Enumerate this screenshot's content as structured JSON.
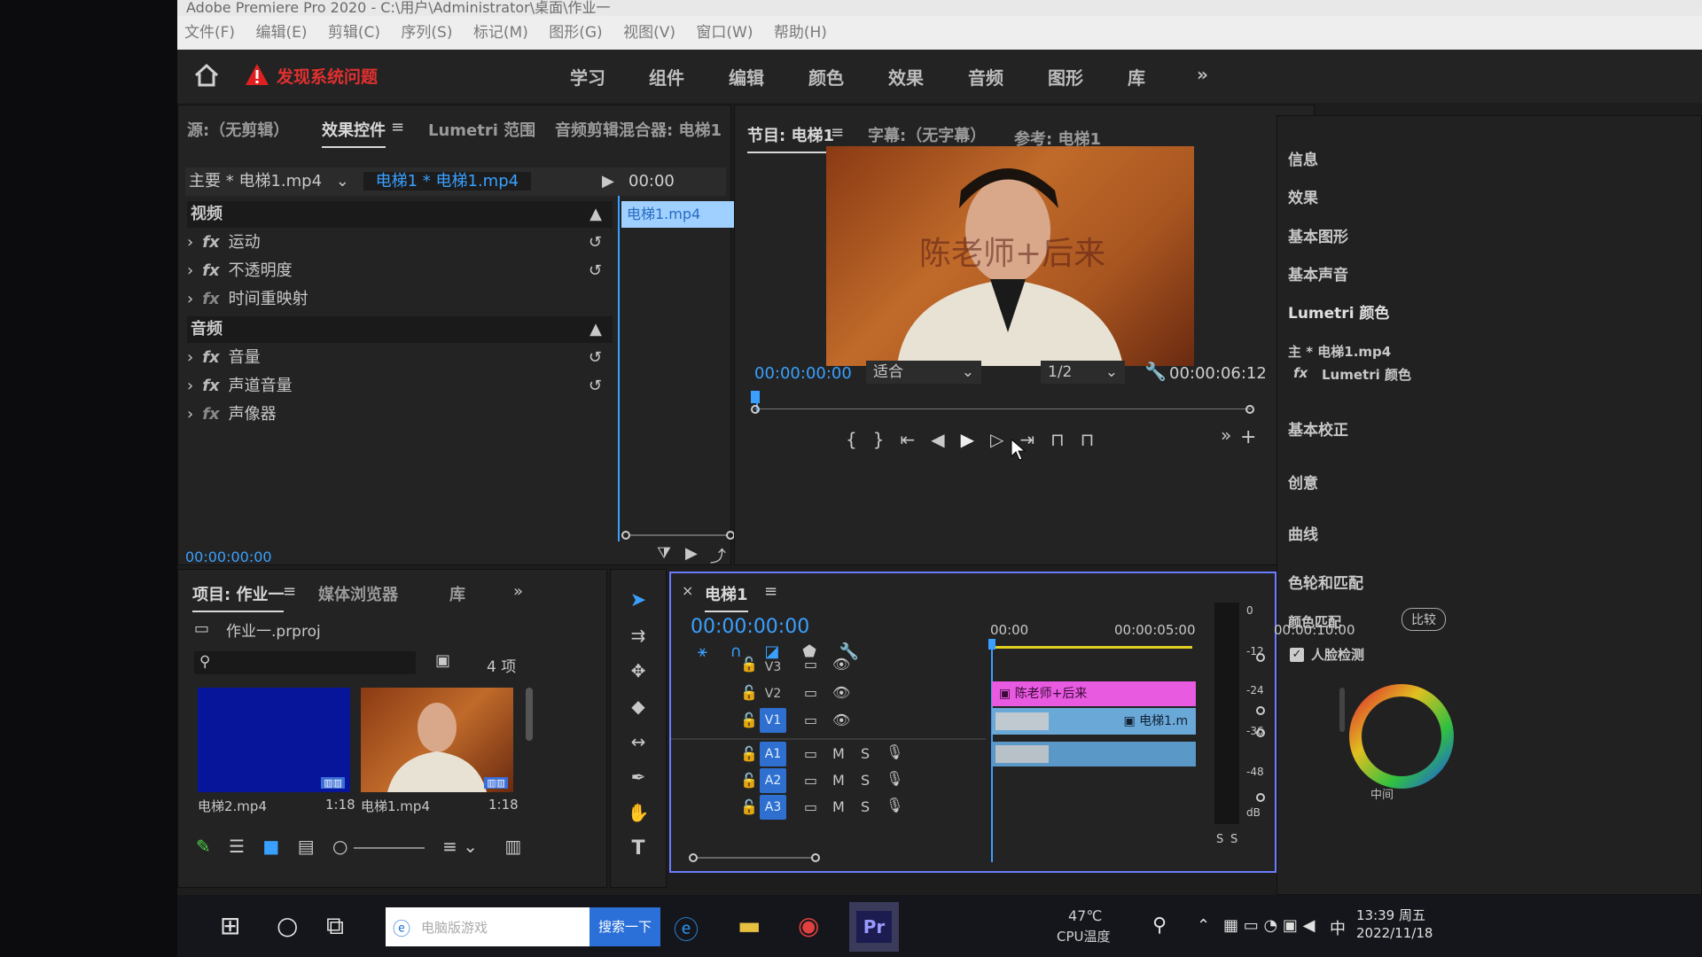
{
  "window_title": "Adobe Premiere Pro 2020 - C:\\用户\\Administrator\\桌面\\作业一",
  "menu": [
    "文件(F)",
    "编辑(E)",
    "剪辑(C)",
    "序列(S)",
    "标记(M)",
    "图形(G)",
    "视图(V)",
    "窗口(W)",
    "帮助(H)"
  ],
  "workspaces": [
    "学习",
    "组件",
    "编辑",
    "颜色",
    "效果",
    "音频",
    "图形",
    "库"
  ],
  "warning_text": "发现系统问题",
  "source_panel": {
    "tabs": [
      "源:（无剪辑）",
      "效果控件",
      "Lumetri 范围",
      "音频剪辑混合器: 电梯1"
    ],
    "clip_master": "主要 * 电梯1.mp4",
    "clip_sequence": "电梯1 * 电梯1.mp4",
    "mini_time": "00:00",
    "mini_clip": "电梯1.mp4",
    "video_header": "视频",
    "video_effects": [
      "运动",
      "不透明度",
      "时间重映射"
    ],
    "audio_header": "音频",
    "audio_effects": [
      "音量",
      "声道音量",
      "声像器"
    ],
    "timecode": "00:00:00:00"
  },
  "program_panel": {
    "tabs": [
      "节目: 电梯1",
      "字幕:（无字幕）",
      "参考: 电梯1"
    ],
    "overlay_text": "陈老师+后来",
    "timecode": "00:00:00:00",
    "fit": "适合",
    "resolution": "1/2",
    "duration": "00:00:06:12"
  },
  "right_sidebar": {
    "items": [
      "信息",
      "效果",
      "基本图形",
      "基本声音",
      "Lumetri 颜色"
    ],
    "clip": "主 * 电梯1.mp4",
    "lumetri": "Lumetri 颜色",
    "sections": [
      "基本校正",
      "创意",
      "曲线",
      "色轮和匹配"
    ],
    "color_match": "颜色匹配",
    "compare": "比较",
    "face_detect": "人脸检测",
    "center_label": "中间"
  },
  "project_panel": {
    "tabs": [
      "项目: 作业一",
      "媒体浏览器",
      "库"
    ],
    "project_file": "作业一.prproj",
    "item_count": "4 项",
    "items": [
      {
        "name": "电梯2.mp4",
        "duration": "1:18"
      },
      {
        "name": "电梯1.mp4",
        "duration": "1:18"
      }
    ]
  },
  "timeline": {
    "tab": "电梯1",
    "timecode": "00:00:00:00",
    "ruler": [
      "00:00",
      "00:00:05:00",
      "00:00:10:00"
    ],
    "video_tracks": [
      "V3",
      "V2",
      "V1"
    ],
    "audio_tracks": [
      "A1",
      "A2",
      "A3"
    ],
    "clip_title": "陈老师+后来",
    "clip_v1": "电梯1.m"
  },
  "meter": {
    "scale": [
      "0",
      "-12",
      "-24",
      "-36",
      "-48",
      "dB"
    ],
    "solo": [
      "S",
      "S"
    ]
  },
  "taskbar": {
    "search_placeholder": "电脑版游戏",
    "search_button": "搜索一下",
    "temp": "47℃",
    "temp_label": "CPU温度",
    "time": "13:39 周五",
    "date": "2022/11/18",
    "ime": "中"
  }
}
